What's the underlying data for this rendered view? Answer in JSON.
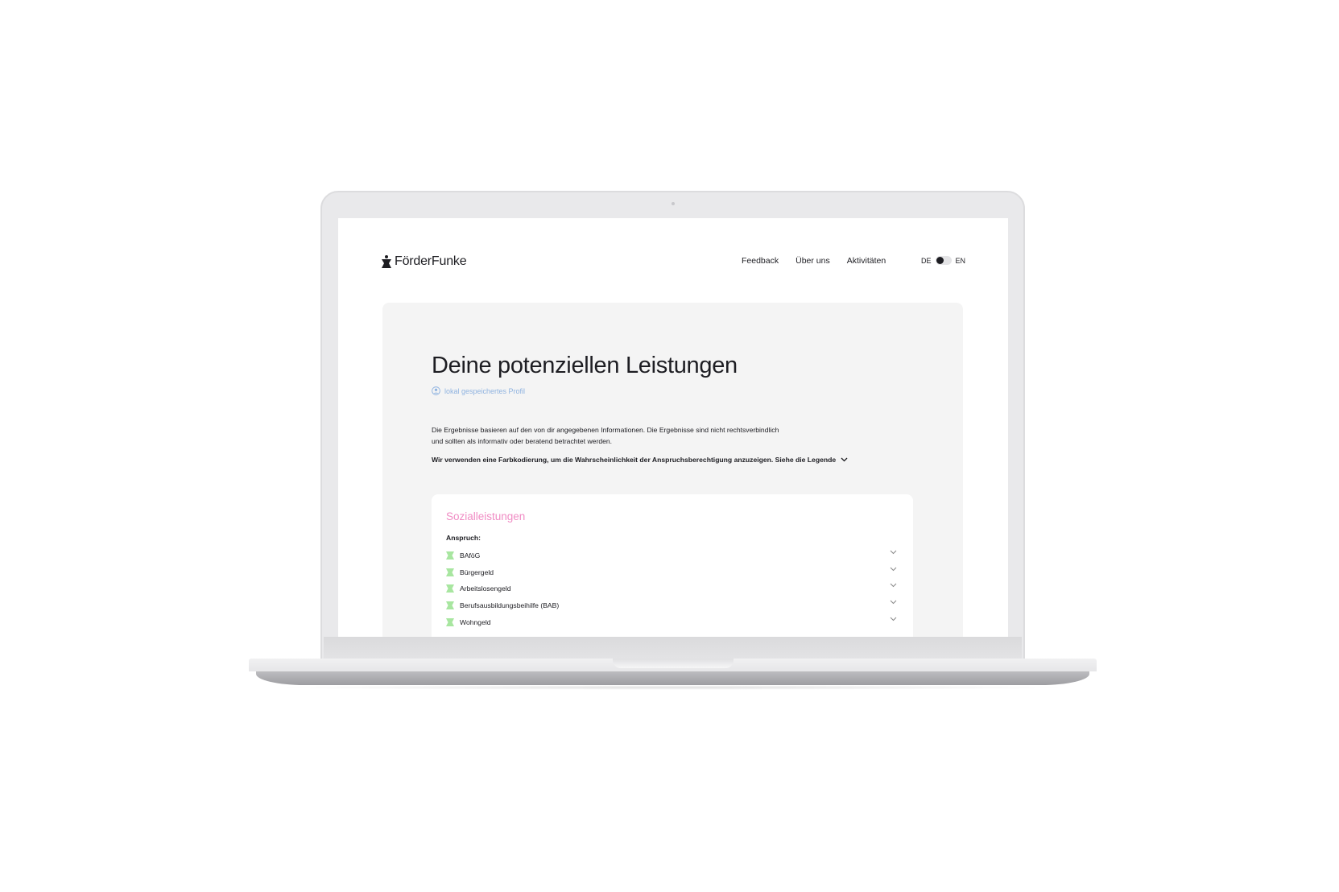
{
  "header": {
    "logo": "FörderFunke",
    "nav": [
      "Feedback",
      "Über uns",
      "Aktivitäten"
    ],
    "lang": {
      "left": "DE",
      "right": "EN",
      "selected": "DE"
    }
  },
  "main": {
    "title": "Deine potenziellen Leistungen",
    "profile_label": "lokal gespeichertes Profil",
    "disclaimer_1": "Die Ergebnisse basieren auf den von dir angegebenen Informationen. Die Ergebnisse sind nicht rechtsverbindlich",
    "disclaimer_2": "und sollten als informativ oder beratend betrachtet werden.",
    "legend_text": "Wir verwenden eine Farbkodierung, um die Wahrscheinlichkeit der Anspruchsberechtigung anzuzeigen. Siehe die Legende",
    "card": {
      "title": "Sozialleistungen",
      "section_label": "Anspruch:",
      "items": [
        "BAföG",
        "Bürgergeld",
        "Arbeitslosengeld",
        "Berufsausbildungsbeihilfe (BAB)",
        "Wohngeld"
      ]
    }
  },
  "colors": {
    "accent_pink": "#f08cc4",
    "eligible_green": "#a8e6a0",
    "profile_blue": "#8fb3e0"
  }
}
